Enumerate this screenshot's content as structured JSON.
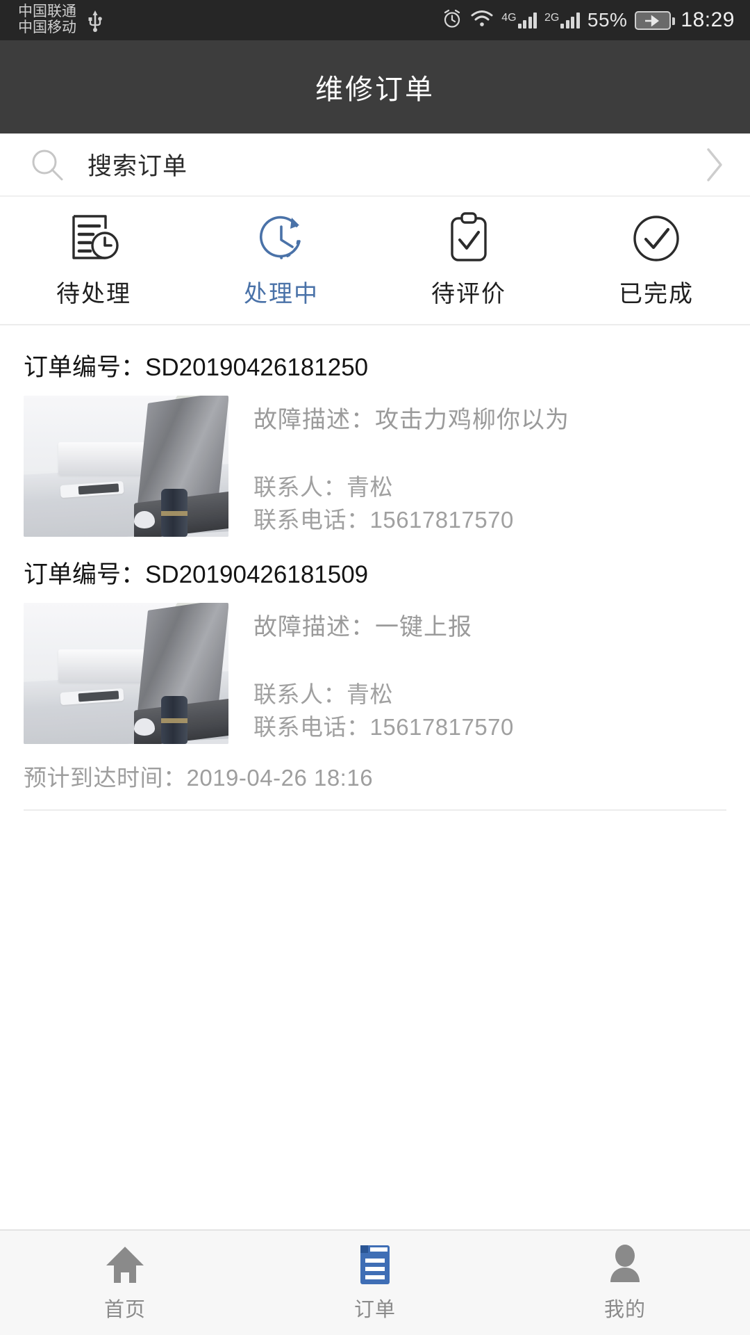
{
  "status_bar": {
    "carrier_primary": "中国联通",
    "carrier_secondary": "中国移动",
    "usb_icon": "usb-icon",
    "alarm_icon": "alarm-clock-icon",
    "wifi_icon": "wifi-icon",
    "network_1": "4G",
    "network_2": "2G",
    "battery_percent": "55%",
    "battery_icon": "battery-charging-icon",
    "time": "18:29"
  },
  "header": {
    "title": "维修订单"
  },
  "search": {
    "icon": "search-icon",
    "placeholder": "搜索订单",
    "chevron_icon": "chevron-right-icon"
  },
  "tabs": {
    "active_color": "#4a72a8",
    "items": [
      {
        "label": "待处理",
        "icon": "document-clock-icon",
        "active": false
      },
      {
        "label": "处理中",
        "icon": "clock-arrow-icon",
        "active": true
      },
      {
        "label": "待评价",
        "icon": "clipboard-check-icon",
        "active": false
      },
      {
        "label": "已完成",
        "icon": "circle-check-icon",
        "active": false
      }
    ]
  },
  "orders": [
    {
      "order_no_label": "订单编号：",
      "order_no_value": "SD20190426181250",
      "thumbnail": "desk-laptop-photo",
      "desc_label": "故障描述：",
      "desc_value": "攻击力鸡柳你以为",
      "contact_label": "联系人：",
      "contact_value": "青松",
      "phone_label": "联系电话：",
      "phone_value": "15617817570",
      "eta": ""
    },
    {
      "order_no_label": "订单编号：",
      "order_no_value": "SD20190426181509",
      "thumbnail": "desk-laptop-photo",
      "desc_label": "故障描述：",
      "desc_value": "一键上报",
      "contact_label": "联系人：",
      "contact_value": "青松",
      "phone_label": "联系电话：",
      "phone_value": "15617817570",
      "eta": "预计到达时间：2019-04-26 18:16"
    }
  ],
  "bottom_nav": {
    "items": [
      {
        "label": "首页",
        "icon": "home-icon",
        "active": false
      },
      {
        "label": "订单",
        "icon": "order-list-icon",
        "active": true
      },
      {
        "label": "我的",
        "icon": "person-icon",
        "active": false
      }
    ]
  }
}
